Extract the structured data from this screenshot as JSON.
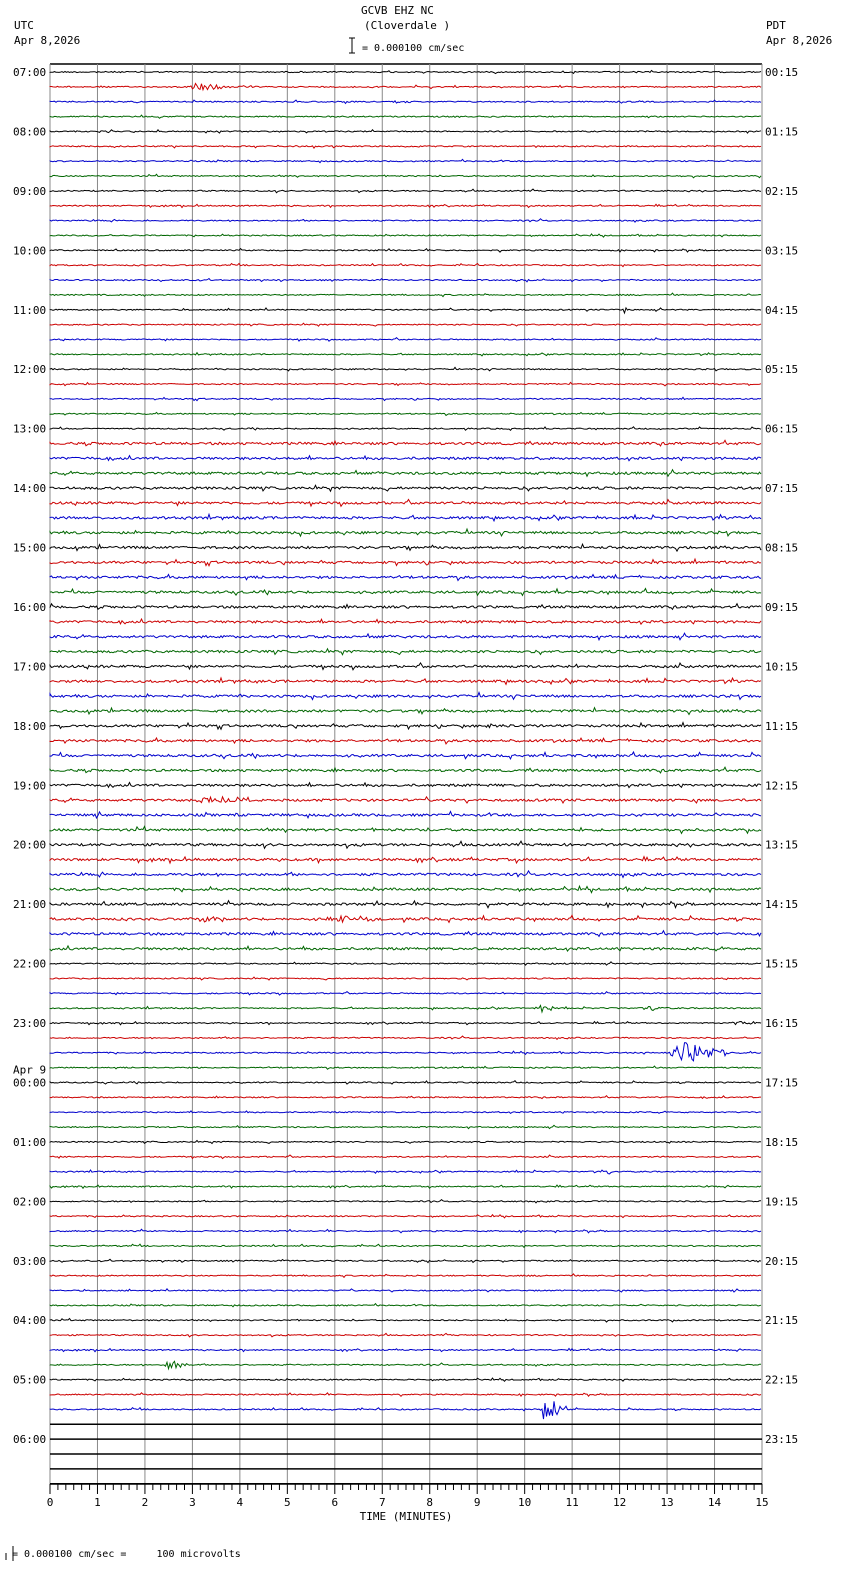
{
  "header": {
    "title": "GCVB EHZ NC",
    "subtitle": "(Cloverdale )",
    "left_tz": "UTC",
    "left_date": "Apr 8,2026",
    "right_tz": "PDT",
    "right_date": "Apr 8,2026",
    "scale_text": "= 0.000100 cm/sec"
  },
  "footer": {
    "scale_text": "= 0.000100 cm/sec =     100 microvolts"
  },
  "chart_data": {
    "type": "helicorder",
    "xlabel": "TIME (MINUTES)",
    "xlim": [
      0,
      15
    ],
    "x_ticks": [
      "0",
      "1",
      "2",
      "3",
      "4",
      "5",
      "6",
      "7",
      "8",
      "9",
      "10",
      "11",
      "12",
      "13",
      "14",
      "15"
    ],
    "minutes_per_row": 15,
    "row_count": 96,
    "rows_with_data": 91,
    "trace_colors": [
      "#000000",
      "#cc0000",
      "#0000cc",
      "#006600"
    ],
    "grid": true,
    "left_labels": [
      "07:00",
      "08:00",
      "09:00",
      "10:00",
      "11:00",
      "12:00",
      "13:00",
      "14:00",
      "15:00",
      "16:00",
      "17:00",
      "18:00",
      "19:00",
      "20:00",
      "21:00",
      "22:00",
      "23:00",
      "00:00",
      "01:00",
      "02:00",
      "03:00",
      "04:00",
      "05:00",
      "06:00"
    ],
    "left_date_change": "Apr 9",
    "right_labels": [
      "00:15",
      "01:15",
      "02:15",
      "03:15",
      "04:15",
      "05:15",
      "06:15",
      "07:15",
      "08:15",
      "09:15",
      "10:15",
      "11:15",
      "12:15",
      "13:15",
      "14:15",
      "15:15",
      "16:15",
      "17:15",
      "18:15",
      "19:15",
      "20:15",
      "21:15",
      "22:15",
      "23:15"
    ],
    "events": [
      {
        "row": 1,
        "start": 2.9,
        "end": 3.9,
        "amp": 4
      },
      {
        "row": 2,
        "start": 7.2,
        "end": 7.6,
        "amp": 1.5
      },
      {
        "row": 16,
        "start": 12.05,
        "end": 12.15,
        "amp": 6
      },
      {
        "row": 44,
        "start": 9.0,
        "end": 10.0,
        "amp": 2
      },
      {
        "row": 49,
        "start": 3.0,
        "end": 4.4,
        "amp": 4
      },
      {
        "row": 57,
        "start": 3.1,
        "end": 3.6,
        "amp": 2.5
      },
      {
        "row": 57,
        "start": 5.8,
        "end": 7.0,
        "amp": 3.5
      },
      {
        "row": 63,
        "start": 10.3,
        "end": 10.6,
        "amp": 5
      },
      {
        "row": 63,
        "start": 12.5,
        "end": 13.1,
        "amp": 2
      },
      {
        "row": 64,
        "start": 14.3,
        "end": 15.0,
        "amp": 2
      },
      {
        "row": 66,
        "start": 13.0,
        "end": 14.3,
        "amp": 11
      },
      {
        "row": 74,
        "start": 11.75,
        "end": 11.85,
        "amp": 5
      },
      {
        "row": 87,
        "start": 2.4,
        "end": 2.9,
        "amp": 7
      },
      {
        "row": 90,
        "start": 10.3,
        "end": 10.9,
        "amp": 14
      }
    ]
  }
}
